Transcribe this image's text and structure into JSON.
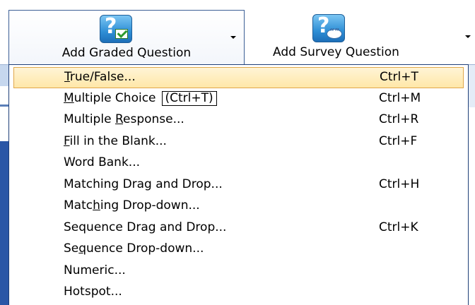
{
  "ribbon": {
    "graded_button": {
      "label": "Add Graded Question",
      "icon": "question-check-icon"
    },
    "survey_button": {
      "label": "Add Survey Question",
      "icon": "question-speech-icon"
    }
  },
  "menu": {
    "items": [
      {
        "pre": "",
        "mnemonic": "T",
        "post": "rue/False...",
        "accel": "Ctrl+T",
        "highlighted": true
      },
      {
        "pre": "",
        "mnemonic": "M",
        "post": "ultiple Choice",
        "accel": "Ctrl+M",
        "tooltip": "(Ctrl+T)"
      },
      {
        "pre": "Multiple ",
        "mnemonic": "R",
        "post": "esponse...",
        "accel": "Ctrl+R"
      },
      {
        "pre": "",
        "mnemonic": "F",
        "post": "ill in the Blank...",
        "accel": "Ctrl+F"
      },
      {
        "pre": "Word Bank...",
        "mnemonic": "",
        "post": "",
        "accel": ""
      },
      {
        "pre": "Matching Drag and Drop...",
        "mnemonic": "",
        "post": "",
        "accel": "Ctrl+H"
      },
      {
        "pre": "Matc",
        "mnemonic": "h",
        "post": "ing Drop-down...",
        "accel": ""
      },
      {
        "pre": "Sequence Drag and Drop...",
        "mnemonic": "",
        "post": "",
        "accel": "Ctrl+K"
      },
      {
        "pre": "Se",
        "mnemonic": "q",
        "post": "uence Drop-down...",
        "accel": ""
      },
      {
        "pre": "Numeric...",
        "mnemonic": "",
        "post": "",
        "accel": ""
      },
      {
        "pre": "Hotspot...",
        "mnemonic": "",
        "post": "",
        "accel": ""
      }
    ]
  },
  "colors": {
    "highlight_fill": "#ffe7a8",
    "highlight_border": "#e0a74a",
    "menu_border": "#1f3f78",
    "ribbon_border": "#3c5f96"
  }
}
